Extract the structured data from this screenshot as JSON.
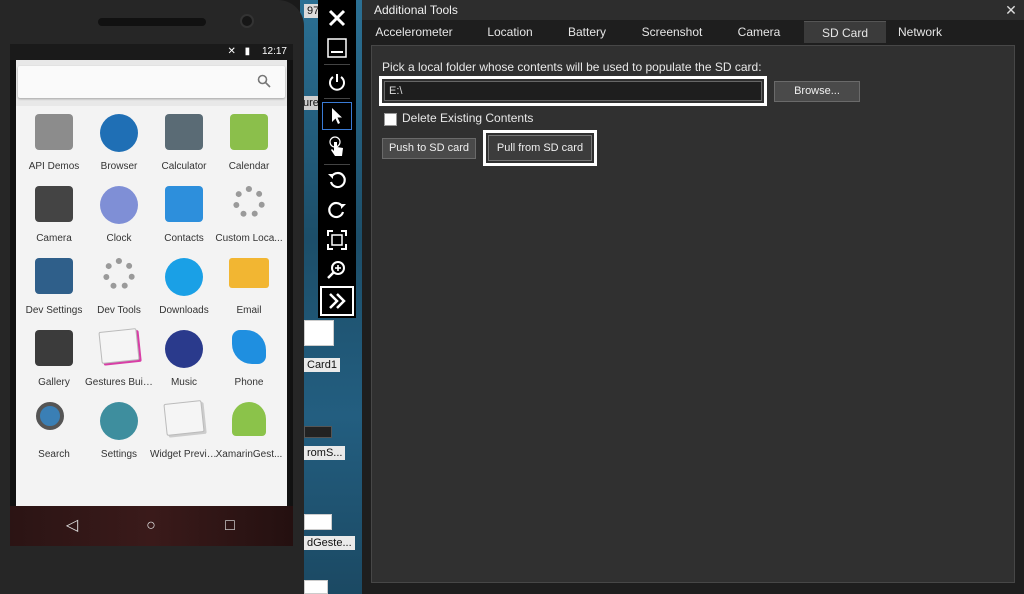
{
  "phone": {
    "time": "12:17",
    "status_icons": "✕ ▮",
    "apps": [
      {
        "label": "API Demos",
        "icon": "folder-gear-icon",
        "color": "#8c8c8c"
      },
      {
        "label": "Browser",
        "icon": "globe-icon",
        "color": "#1f6fb5"
      },
      {
        "label": "Calculator",
        "icon": "calculator-icon",
        "color": "#5a6b75"
      },
      {
        "label": "Calendar",
        "icon": "calendar-icon",
        "color": "#8bbf4b"
      },
      {
        "label": "Camera",
        "icon": "camera-icon",
        "color": "#444"
      },
      {
        "label": "Clock",
        "icon": "clock-icon",
        "color": "#7f8fd6"
      },
      {
        "label": "Contacts",
        "icon": "contacts-icon",
        "color": "#2d8fdc"
      },
      {
        "label": "Custom Loca...",
        "icon": "gear-cluster-icon",
        "color": "#9a9a9a"
      },
      {
        "label": "Dev Settings",
        "icon": "sliders-icon",
        "color": "#2f5f8a"
      },
      {
        "label": "Dev Tools",
        "icon": "gear-cluster-icon",
        "color": "#9a9a9a"
      },
      {
        "label": "Downloads",
        "icon": "download-icon",
        "color": "#1aa0e6"
      },
      {
        "label": "Email",
        "icon": "envelope-icon",
        "color": "#f2b632"
      },
      {
        "label": "Gallery",
        "icon": "photo-icon",
        "color": "#3b3b3b"
      },
      {
        "label": "Gestures Buil...",
        "icon": "gesture-icon",
        "color": "#d83ea6"
      },
      {
        "label": "Music",
        "icon": "speaker-icon",
        "color": "#2a3a8c"
      },
      {
        "label": "Phone",
        "icon": "phone-icon",
        "color": "#1f8fe0"
      },
      {
        "label": "Search",
        "icon": "magnifier-icon",
        "color": "#3a7fb5"
      },
      {
        "label": "Settings",
        "icon": "settings-gear-icon",
        "color": "#3e8e9e"
      },
      {
        "label": "Widget Previe...",
        "icon": "widget-icon",
        "color": "#cccccc"
      },
      {
        "label": "XamarinGest...",
        "icon": "android-icon",
        "color": "#8bc34a"
      }
    ]
  },
  "desktop": {
    "snippets": [
      "97",
      "ure",
      "Card1",
      "romS...",
      "dGeste..."
    ]
  },
  "toolbar": {
    "buttons": [
      "close",
      "minimize",
      "power",
      "select-pointer",
      "touch",
      "rotate-left",
      "rotate-right",
      "fit-screen",
      "zoom",
      "more"
    ]
  },
  "tools": {
    "title": "Additional Tools",
    "close_label": "✕",
    "tabs": [
      "Accelerometer",
      "Location",
      "Battery",
      "Screenshot",
      "Camera",
      "SD Card",
      "Network"
    ],
    "active_tab": "SD Card",
    "prompt": "Pick a local folder whose contents will be used to populate the SD card:",
    "path_value": "E:\\",
    "browse_label": "Browse...",
    "delete_label": "Delete Existing Contents",
    "delete_checked": false,
    "push_label": "Push to SD card",
    "pull_label": "Pull from SD card"
  }
}
